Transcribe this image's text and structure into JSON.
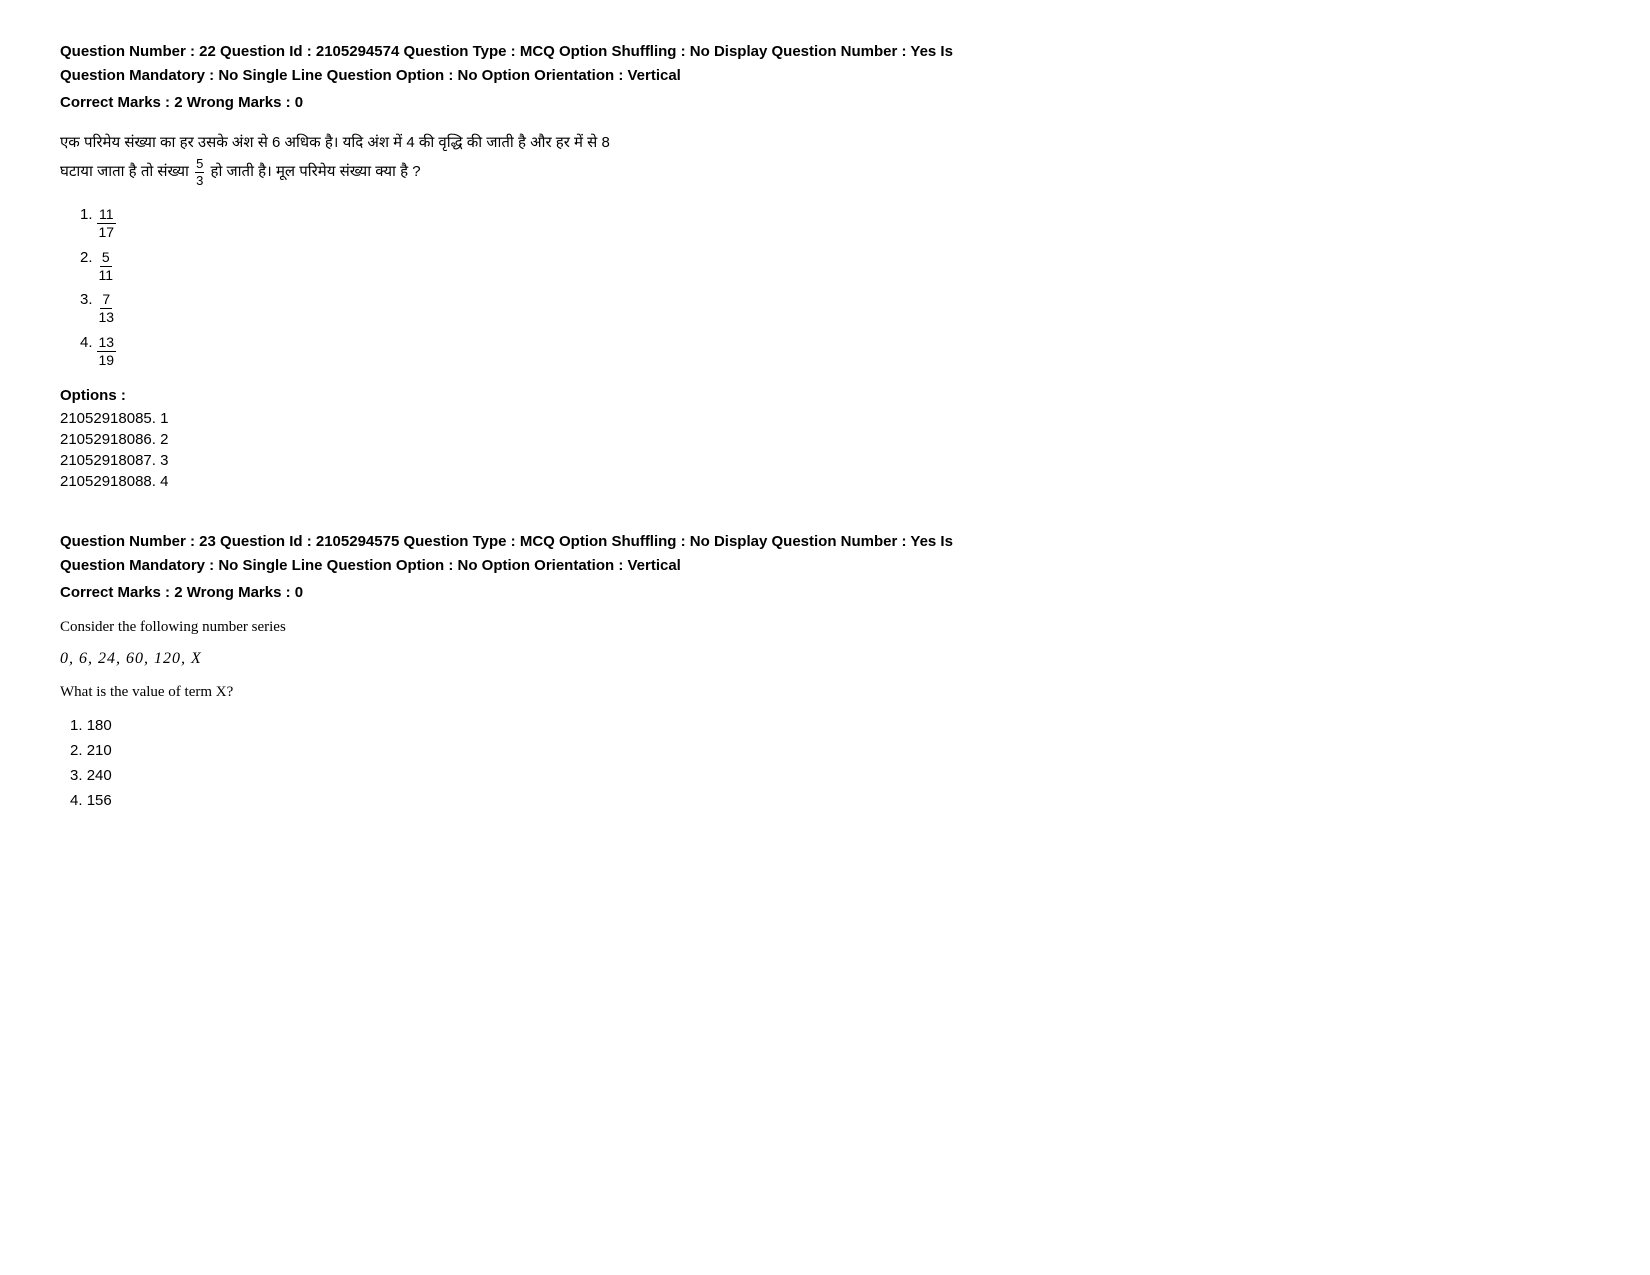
{
  "questions": [
    {
      "id": "q22",
      "meta_line1": "Question Number : 22 Question Id : 2105294574 Question Type : MCQ Option Shuffling : No Display Question Number : Yes Is",
      "meta_line2": "Question Mandatory : No Single Line Question Option : No Option Orientation : Vertical",
      "marks": "Correct Marks : 2 Wrong Marks : 0",
      "question_hindi_1": "एक परिमेय संख्या का हर उसके अंश से 6 अधिक है। यदि अंश में 4 की वृद्धि की जाती है और हर में से 8",
      "question_hindi_2": "घटाया जाता है तो संख्या",
      "question_hindi_fraction_num": "5",
      "question_hindi_fraction_den": "3",
      "question_hindi_3": "हो जाती है। मूल परिमेय संख्या क्या है ?",
      "options": [
        {
          "num": "1",
          "frac_num": "11",
          "frac_den": "17"
        },
        {
          "num": "2",
          "frac_num": "5",
          "frac_den": "11"
        },
        {
          "num": "3",
          "frac_num": "7",
          "frac_den": "13"
        },
        {
          "num": "4",
          "frac_num": "13",
          "frac_den": "19"
        }
      ],
      "options_label": "Options :",
      "option_ids": [
        "21052918085. 1",
        "21052918086. 2",
        "21052918087. 3",
        "21052918088. 4"
      ]
    },
    {
      "id": "q23",
      "meta_line1": "Question Number : 23 Question Id : 2105294575 Question Type : MCQ Option Shuffling : No Display Question Number : Yes Is",
      "meta_line2": "Question Mandatory : No Single Line Question Option : No Option Orientation : Vertical",
      "marks": "Correct Marks : 2 Wrong Marks : 0",
      "intro_text": "Consider the following number series",
      "series": "0, 6, 24, 60, 120, X",
      "question_text": "What is the value of term X?",
      "options": [
        {
          "num": "1",
          "value": "180"
        },
        {
          "num": "2",
          "value": "210"
        },
        {
          "num": "3",
          "value": "240"
        },
        {
          "num": "4",
          "value": "156"
        }
      ]
    }
  ]
}
